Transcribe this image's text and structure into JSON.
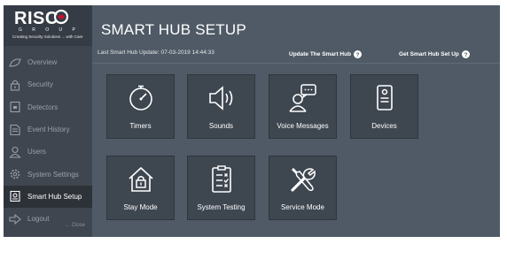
{
  "brand": {
    "name": "RISC",
    "sub": "G R O U P",
    "tagline": "Creating Security Solutions ... with Care"
  },
  "sidebar": {
    "items": [
      {
        "label": "Overview",
        "icon": "overview-icon"
      },
      {
        "label": "Security",
        "icon": "lock-icon"
      },
      {
        "label": "Detectors",
        "icon": "detector-icon"
      },
      {
        "label": "Event History",
        "icon": "event-history-icon"
      },
      {
        "label": "Users",
        "icon": "users-icon"
      },
      {
        "label": "System Settings",
        "icon": "gear-icon"
      },
      {
        "label": "Smart Hub Setup",
        "icon": "smart-hub-icon",
        "active": true
      },
      {
        "label": "Logout",
        "icon": "logout-icon"
      }
    ],
    "close_label": "← Close"
  },
  "header": {
    "title": "SMART HUB SETUP",
    "last_update": "Last Smart Hub Update: 07-03-2019 14:44:33",
    "update_link": "Update The Smart Hub",
    "getsetup_link": "Get Smart Hub Set Up"
  },
  "tiles": [
    {
      "label": "Timers",
      "icon": "timer-icon"
    },
    {
      "label": "Sounds",
      "icon": "speaker-icon"
    },
    {
      "label": "Voice Messages",
      "icon": "voice-message-icon"
    },
    {
      "label": "Devices",
      "icon": "device-icon"
    },
    {
      "label": "Stay Mode",
      "icon": "home-lock-icon"
    },
    {
      "label": "System Testing",
      "icon": "checklist-icon"
    },
    {
      "label": "Service Mode",
      "icon": "tools-icon"
    }
  ],
  "colors": {
    "sidebar_bg": "#3f4650",
    "main_bg": "#4f5a66",
    "tile_bg": "#3e4650",
    "active_bg": "#2d3238"
  }
}
